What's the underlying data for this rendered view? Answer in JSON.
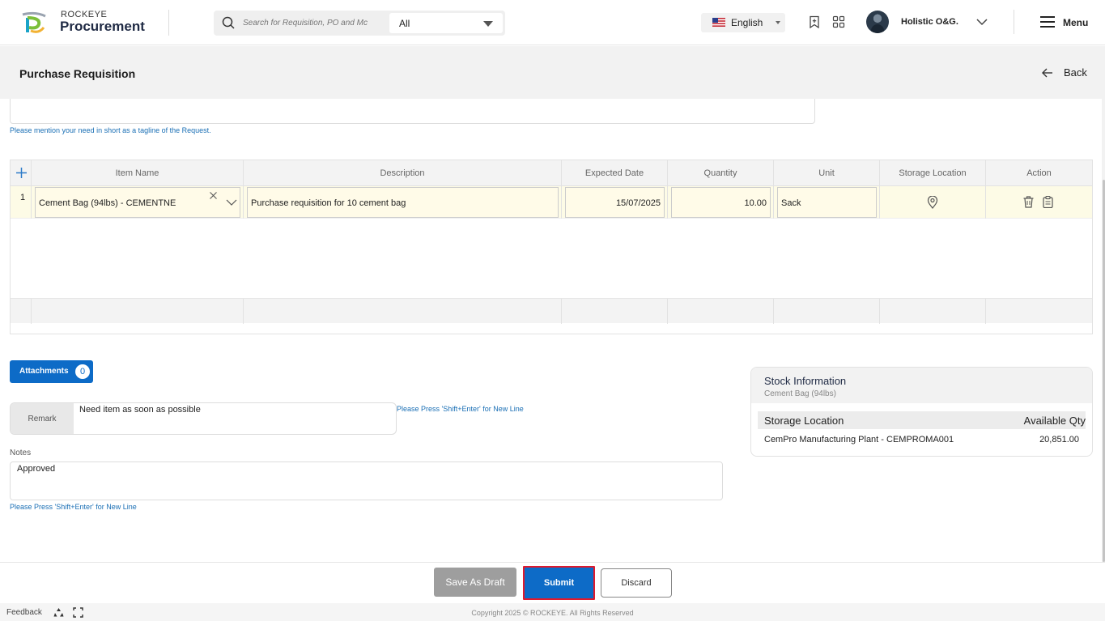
{
  "header": {
    "brand_small": "ROCKEYE",
    "brand_big": "Procurement",
    "search_placeholder": "Search for Requisition, PO and Mc",
    "search_scope": "All",
    "language": "English",
    "user_name": "Holistic O&G.",
    "menu_label": "Menu"
  },
  "page": {
    "title": "Purchase Requisition",
    "back_label": "Back",
    "tagline_hint": "Please mention your need in short as a tagline of the Request."
  },
  "grid": {
    "columns": [
      "Item Name",
      "Description",
      "Expected Date",
      "Quantity",
      "Unit",
      "Storage Location",
      "Action"
    ],
    "rows": [
      {
        "num": "1",
        "item_name": "Cement Bag (94lbs) - CEMENTNE",
        "description": "Purchase requisition for 10 cement bag",
        "expected_date": "15/07/2025",
        "quantity": "10.00",
        "unit": "Sack"
      }
    ]
  },
  "attachments": {
    "label": "Attachments",
    "count": "0"
  },
  "remark": {
    "label": "Remark",
    "value": "Need item as soon as possible",
    "hint": "Please Press 'Shift+Enter' for New Line"
  },
  "notes": {
    "label": "Notes",
    "value": "Approved",
    "hint": "Please Press 'Shift+Enter' for New Line"
  },
  "stock": {
    "title": "Stock Information",
    "subtitle": "Cement Bag (94lbs)",
    "col_location": "Storage Location",
    "col_qty": "Available Qty",
    "rows": [
      {
        "location": "CemPro Manufacturing Plant - CEMPROMA001",
        "qty": "20,851.00"
      }
    ]
  },
  "actions": {
    "save_draft": "Save As Draft",
    "submit": "Submit",
    "discard": "Discard"
  },
  "footer": {
    "feedback": "Feedback",
    "copyright": "Copyright 2025 © ROCKEYE. All Rights Reserved"
  },
  "colors": {
    "primary": "#0d6bc7",
    "highlight_border": "#e0192d",
    "row_highlight": "#fdfbe6"
  }
}
